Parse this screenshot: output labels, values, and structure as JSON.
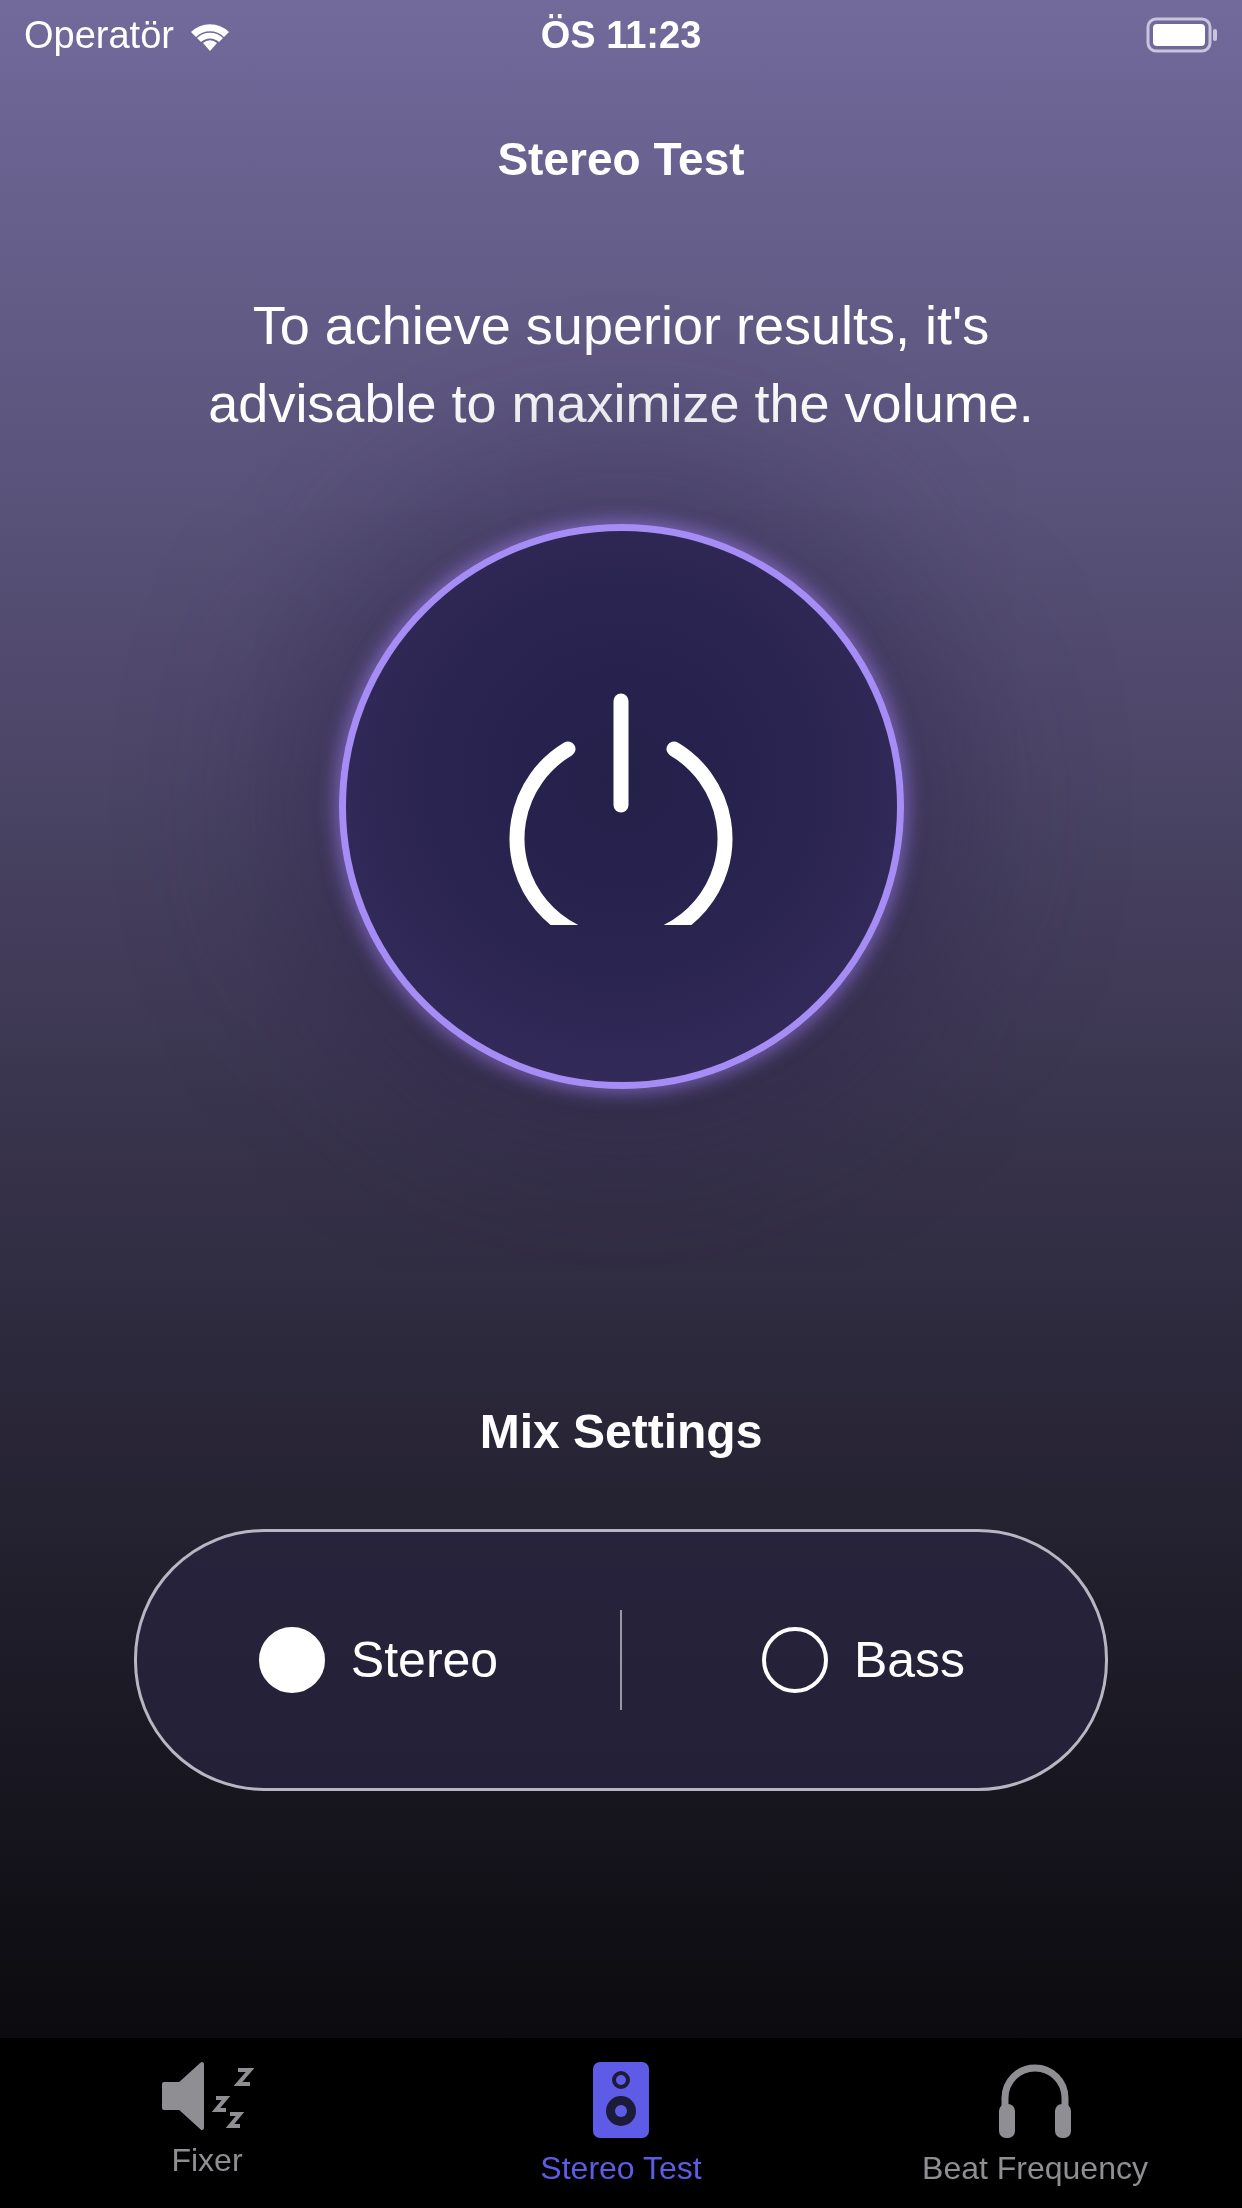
{
  "status_bar": {
    "carrier": "Operatör",
    "time": "ÖS 11:23"
  },
  "title": "Stereo Test",
  "message": "To achieve superior results, it's advisable to maximize the volume.",
  "mix_settings": {
    "heading": "Mix Settings",
    "options": [
      {
        "label": "Stereo",
        "selected": true
      },
      {
        "label": "Bass",
        "selected": false
      }
    ]
  },
  "tabs": [
    {
      "label": "Fixer",
      "kind": "sleep",
      "selected": false
    },
    {
      "label": "Stereo Test",
      "kind": "speaker",
      "selected": true
    },
    {
      "label": "Beat Frequency",
      "kind": "headphones",
      "selected": false
    }
  ]
}
